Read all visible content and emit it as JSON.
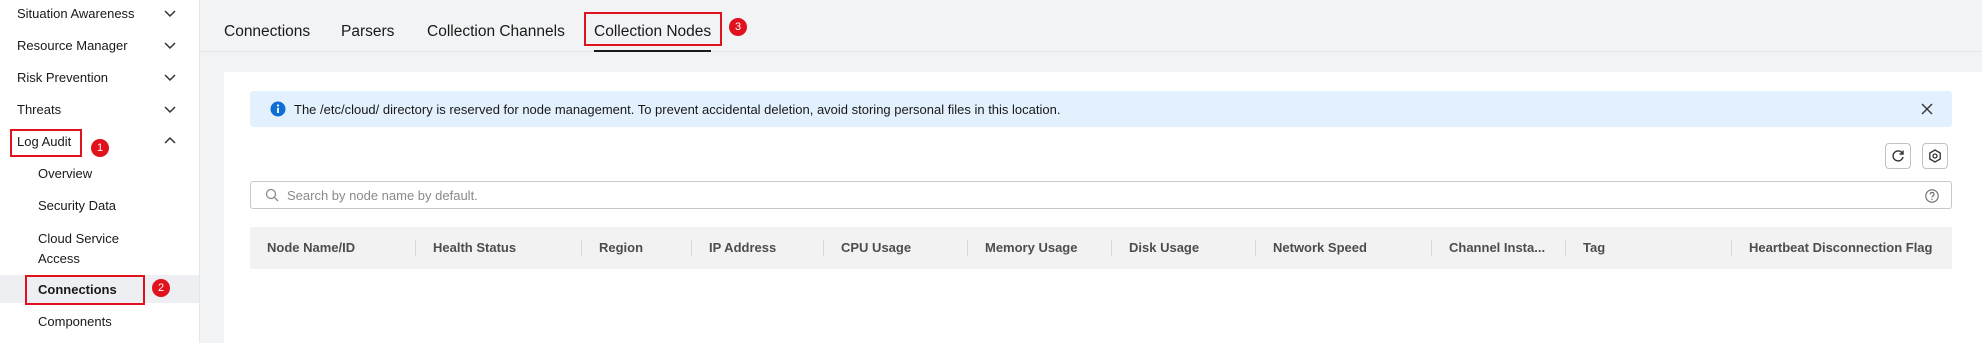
{
  "sidebar": {
    "items": [
      {
        "label": "Situation Awareness",
        "expanded": false
      },
      {
        "label": "Resource Manager",
        "expanded": false
      },
      {
        "label": "Risk Prevention",
        "expanded": false
      },
      {
        "label": "Threats",
        "expanded": false
      },
      {
        "label": "Log Audit",
        "expanded": true
      }
    ],
    "sub_items": [
      {
        "label": "Overview"
      },
      {
        "label": "Security Data"
      },
      {
        "label": "Cloud Service Access",
        "line1": "Cloud Service",
        "line2": "Access"
      },
      {
        "label": "Connections",
        "active": true
      },
      {
        "label": "Components"
      }
    ]
  },
  "tabs": [
    {
      "label": "Connections"
    },
    {
      "label": "Parsers"
    },
    {
      "label": "Collection Channels"
    },
    {
      "label": "Collection Nodes",
      "active": true
    }
  ],
  "annotations": [
    "1",
    "2",
    "3"
  ],
  "alert": {
    "text": "The /etc/cloud/ directory is reserved for node management. To prevent accidental deletion, avoid storing personal files in this location."
  },
  "search": {
    "placeholder": "Search by node name by default.",
    "value": ""
  },
  "table": {
    "columns": [
      "Node Name/ID",
      "Health Status",
      "Region",
      "IP Address",
      "CPU Usage",
      "Memory Usage",
      "Disk Usage",
      "Network Speed",
      "Channel Insta...",
      "Tag",
      "Heartbeat Disconnection Flag"
    ],
    "rows": []
  },
  "colors": {
    "annotation_red": "#e0121d",
    "alert_bg": "#e3f0fd",
    "info_blue": "#0d6fd6"
  }
}
